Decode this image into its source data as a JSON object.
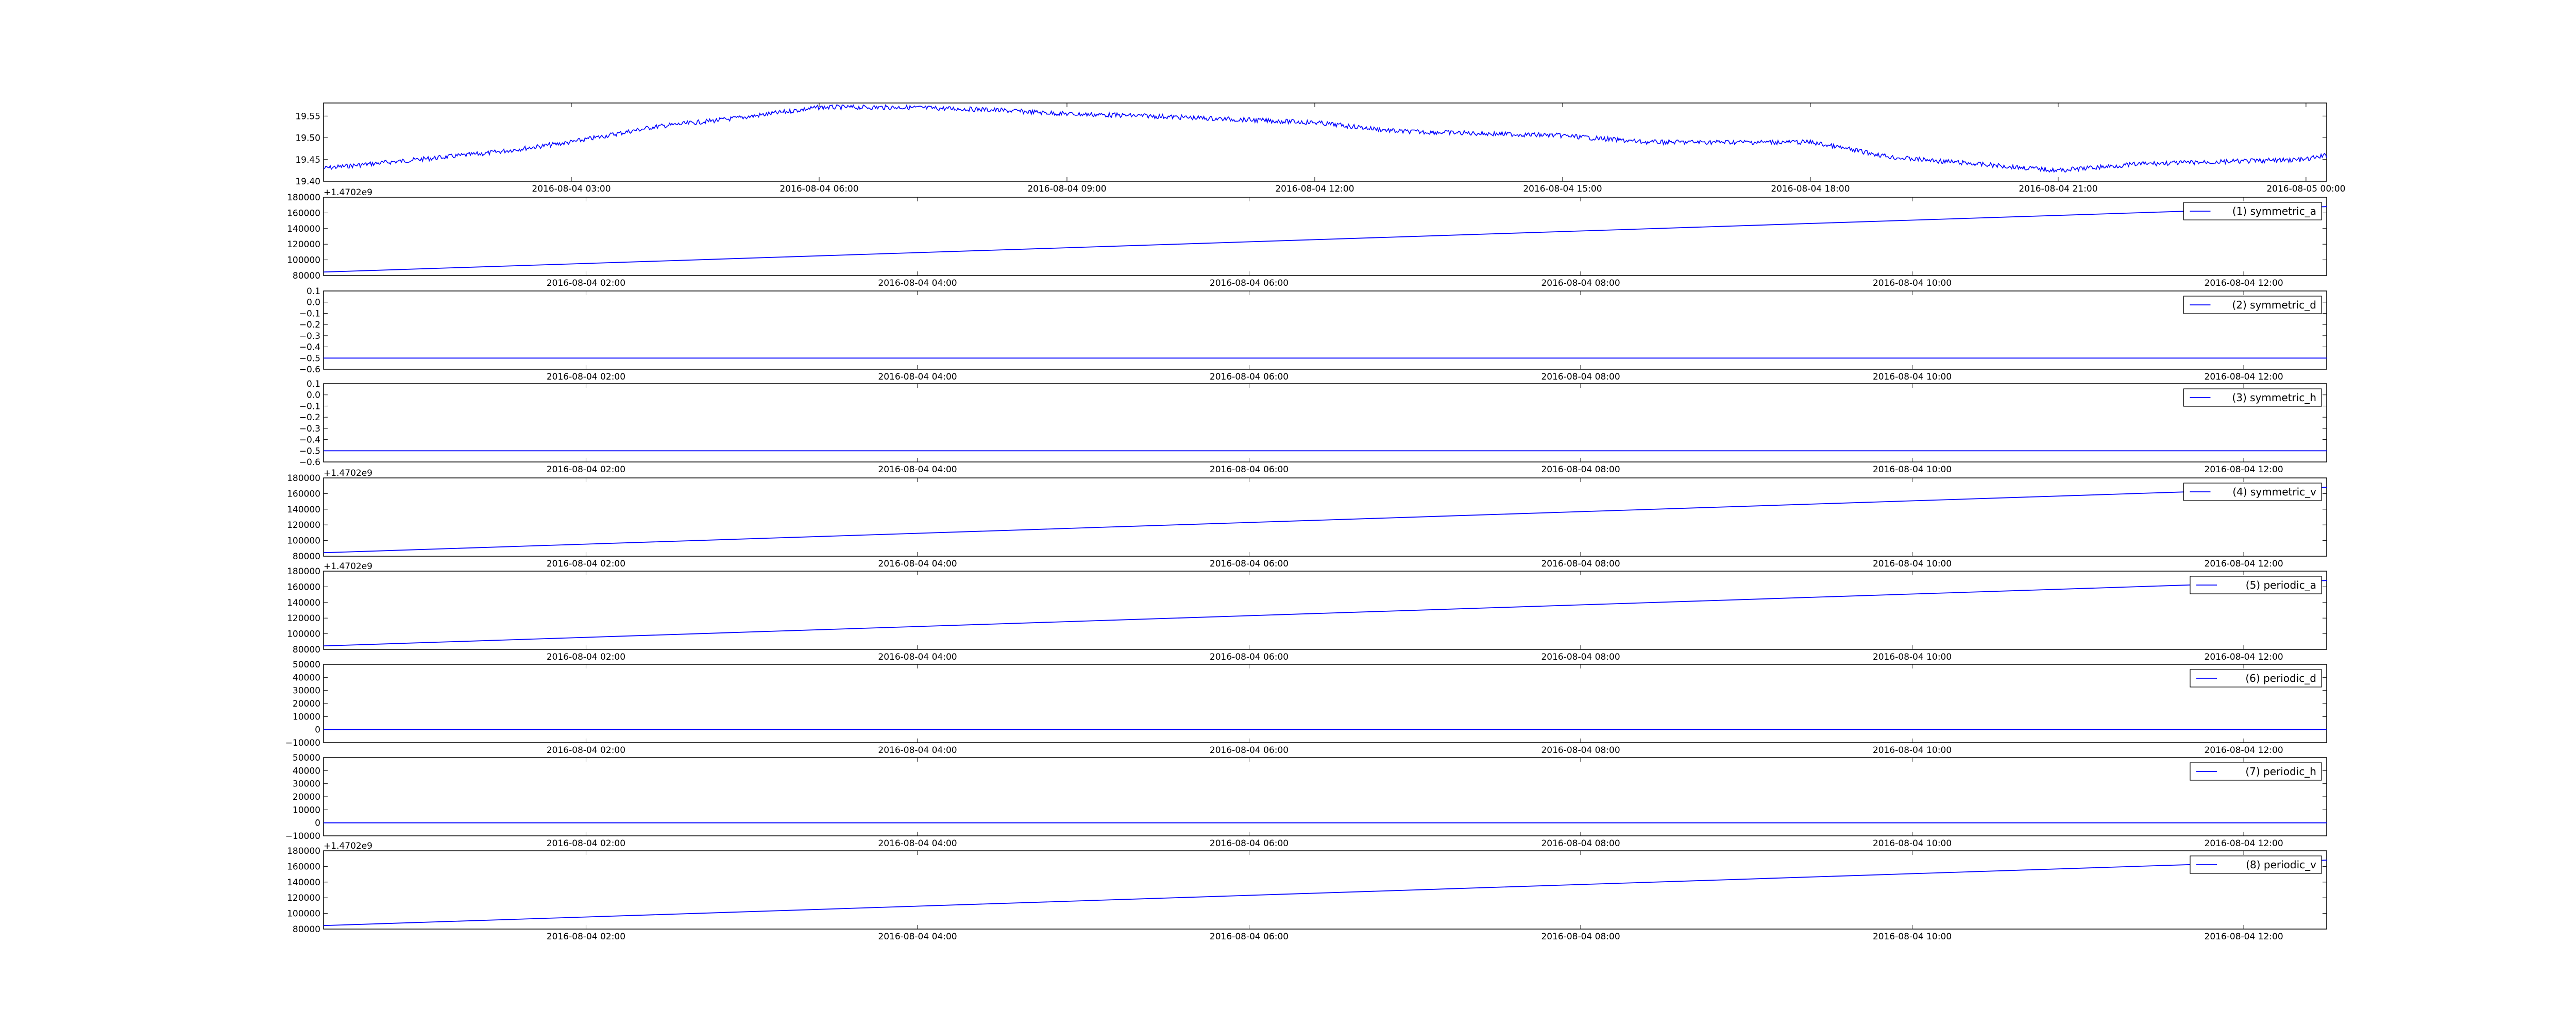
{
  "line_color": "#0000ff",
  "chart_data": [
    {
      "type": "line",
      "title": "",
      "xlabel": "",
      "ylabel": "",
      "x_offset_label": "",
      "legend": "",
      "ylim": [
        19.4,
        19.58
      ],
      "yticks": [
        "19.40",
        "19.45",
        "19.50",
        "19.55"
      ],
      "xticks": [
        "2016-08-04 03:00",
        "2016-08-04 06:00",
        "2016-08-04 09:00",
        "2016-08-04 12:00",
        "2016-08-04 15:00",
        "2016-08-04 18:00",
        "2016-08-04 21:00",
        "2016-08-05 00:00"
      ],
      "x": [
        "2016-08-04 00:00",
        "2016-08-04 02:00",
        "2016-08-04 03:00",
        "2016-08-04 04:00",
        "2016-08-04 05:00",
        "2016-08-04 06:00",
        "2016-08-04 07:00",
        "2016-08-04 08:00",
        "2016-08-04 09:00",
        "2016-08-04 10:00",
        "2016-08-04 12:00",
        "2016-08-04 13:00",
        "2016-08-04 15:00",
        "2016-08-04 16:00",
        "2016-08-04 18:00",
        "2016-08-04 19:00",
        "2016-08-04 20:00",
        "2016-08-04 21:00",
        "2016-08-04 22:00",
        "2016-08-05 00:00",
        "2016-08-05 00:15"
      ],
      "values": [
        19.43,
        19.465,
        19.49,
        19.525,
        19.545,
        19.57,
        19.57,
        19.565,
        19.555,
        19.55,
        19.535,
        19.515,
        19.505,
        19.49,
        19.49,
        19.455,
        19.44,
        19.425,
        19.44,
        19.45,
        19.46
      ]
    },
    {
      "type": "line",
      "x_offset_label": "+1.4702e9",
      "legend": "(1) symmetric_a",
      "ylim": [
        80000,
        180000
      ],
      "yticks": [
        "80000",
        "100000",
        "120000",
        "140000",
        "160000",
        "180000"
      ],
      "xticks": [
        "2016-08-04 02:00",
        "2016-08-04 04:00",
        "2016-08-04 06:00",
        "2016-08-04 08:00",
        "2016-08-04 10:00",
        "2016-08-04 12:00"
      ],
      "x": [
        "2016-08-04 00:25",
        "2016-08-04 12:30"
      ],
      "values": [
        84500,
        168000
      ]
    },
    {
      "type": "line",
      "x_offset_label": "",
      "legend": "(2) symmetric_d",
      "ylim": [
        -0.6,
        0.1
      ],
      "yticks": [
        "−0.6",
        "−0.5",
        "−0.4",
        "−0.3",
        "−0.2",
        "−0.1",
        "0.0",
        "0.1"
      ],
      "xticks": [
        "2016-08-04 02:00",
        "2016-08-04 04:00",
        "2016-08-04 06:00",
        "2016-08-04 08:00",
        "2016-08-04 10:00",
        "2016-08-04 12:00"
      ],
      "x": [
        "2016-08-04 00:25",
        "2016-08-04 12:30"
      ],
      "values": [
        -0.5,
        -0.5
      ]
    },
    {
      "type": "line",
      "x_offset_label": "",
      "legend": "(3) symmetric_h",
      "ylim": [
        -0.6,
        0.1
      ],
      "yticks": [
        "−0.6",
        "−0.5",
        "−0.4",
        "−0.3",
        "−0.2",
        "−0.1",
        "0.0",
        "0.1"
      ],
      "xticks": [
        "2016-08-04 02:00",
        "2016-08-04 04:00",
        "2016-08-04 06:00",
        "2016-08-04 08:00",
        "2016-08-04 10:00",
        "2016-08-04 12:00"
      ],
      "x": [
        "2016-08-04 00:25",
        "2016-08-04 12:30"
      ],
      "values": [
        -0.5,
        -0.5
      ]
    },
    {
      "type": "line",
      "x_offset_label": "+1.4702e9",
      "legend": "(4) symmetric_v",
      "ylim": [
        80000,
        180000
      ],
      "yticks": [
        "80000",
        "100000",
        "120000",
        "140000",
        "160000",
        "180000"
      ],
      "xticks": [
        "2016-08-04 02:00",
        "2016-08-04 04:00",
        "2016-08-04 06:00",
        "2016-08-04 08:00",
        "2016-08-04 10:00",
        "2016-08-04 12:00"
      ],
      "x": [
        "2016-08-04 00:25",
        "2016-08-04 12:30"
      ],
      "values": [
        84500,
        168000
      ]
    },
    {
      "type": "line",
      "x_offset_label": "+1.4702e9",
      "legend": "(5) periodic_a",
      "ylim": [
        80000,
        180000
      ],
      "yticks": [
        "80000",
        "100000",
        "120000",
        "140000",
        "160000",
        "180000"
      ],
      "xticks": [
        "2016-08-04 02:00",
        "2016-08-04 04:00",
        "2016-08-04 06:00",
        "2016-08-04 08:00",
        "2016-08-04 10:00",
        "2016-08-04 12:00"
      ],
      "x": [
        "2016-08-04 00:25",
        "2016-08-04 12:30"
      ],
      "values": [
        84500,
        168000
      ]
    },
    {
      "type": "line",
      "x_offset_label": "",
      "legend": "(6) periodic_d",
      "ylim": [
        -10000,
        50000
      ],
      "yticks": [
        "−10000",
        "0",
        "10000",
        "20000",
        "30000",
        "40000",
        "50000"
      ],
      "xticks": [
        "2016-08-04 02:00",
        "2016-08-04 04:00",
        "2016-08-04 06:00",
        "2016-08-04 08:00",
        "2016-08-04 10:00",
        "2016-08-04 12:00"
      ],
      "x": [
        "2016-08-04 00:25",
        "2016-08-04 12:30"
      ],
      "values": [
        0,
        0
      ]
    },
    {
      "type": "line",
      "x_offset_label": "",
      "legend": "(7) periodic_h",
      "ylim": [
        -10000,
        50000
      ],
      "yticks": [
        "−10000",
        "0",
        "10000",
        "20000",
        "30000",
        "40000",
        "50000"
      ],
      "xticks": [
        "2016-08-04 02:00",
        "2016-08-04 04:00",
        "2016-08-04 06:00",
        "2016-08-04 08:00",
        "2016-08-04 10:00",
        "2016-08-04 12:00"
      ],
      "x": [
        "2016-08-04 00:25",
        "2016-08-04 12:30"
      ],
      "values": [
        0,
        0
      ]
    },
    {
      "type": "line",
      "x_offset_label": "+1.4702e9",
      "legend": "(8) periodic_v",
      "ylim": [
        80000,
        180000
      ],
      "yticks": [
        "80000",
        "100000",
        "120000",
        "140000",
        "160000",
        "180000"
      ],
      "xticks": [
        "2016-08-04 02:00",
        "2016-08-04 04:00",
        "2016-08-04 06:00",
        "2016-08-04 08:00",
        "2016-08-04 10:00",
        "2016-08-04 12:00"
      ],
      "x": [
        "2016-08-04 00:25",
        "2016-08-04 12:30"
      ],
      "values": [
        84500,
        168000
      ]
    }
  ]
}
